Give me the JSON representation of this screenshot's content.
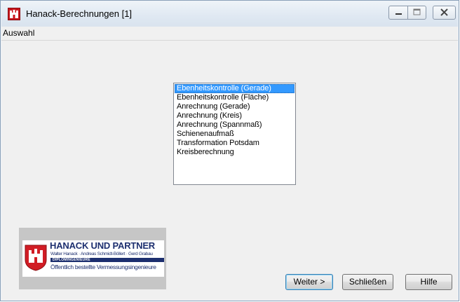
{
  "window": {
    "title": "Hanack-Berechnungen [1]",
    "controls": [
      "minimize-icon",
      "maximize-icon",
      "close-icon"
    ]
  },
  "menu": {
    "items": [
      "Auswahl"
    ]
  },
  "list": {
    "items": [
      "Ebenheitskontrolle (Gerade)",
      "Ebenheitskontrolle (Fläche)",
      "Anrechnung (Gerade)",
      "Anrechnung (Kreis)",
      "Anrechnung (Spannmaß)",
      "Schienenaufmaß",
      "Transformation Potsdam",
      "Kreisberechnung"
    ],
    "selected_index": 0
  },
  "logo": {
    "company": "HANACK UND PARTNER",
    "people": "Walter Hanack · Andreas Schmidt-Böllert · Gerd Grabau",
    "degree": "DIPLOMINGENIEURE",
    "description": "Öffentlich bestellte Vermessungsingenieure"
  },
  "buttons": {
    "next": "Weiter >",
    "close": "Schließen",
    "help": "Hilfe"
  },
  "colors": {
    "selection": "#3399ff",
    "logo_blue": "#1d2f6f",
    "app_icon_red": "#c7161d"
  }
}
